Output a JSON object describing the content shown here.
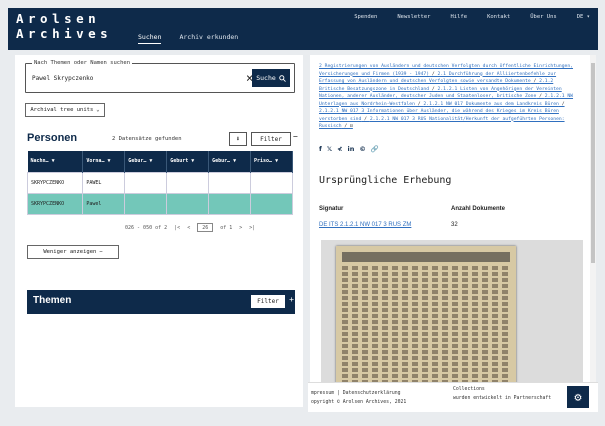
{
  "header": {
    "logo_line1": "Arolsen",
    "logo_line2": "Archives",
    "nav_main": [
      "Suchen",
      "Archiv erkunden"
    ],
    "nav_top": [
      "Spenden",
      "Newsletter",
      "Hilfe",
      "Kontakt",
      "Über Uns",
      "DE ▾"
    ]
  },
  "search": {
    "legend": "Nach Themen oder Namen suchen",
    "value": "Pawel Skrypczenko",
    "button_label": "Suche",
    "archival_label": "Archival tree units"
  },
  "personen": {
    "title": "Personen",
    "count": "2 Datensätze gefunden",
    "filter_label": "Filter",
    "columns": [
      "Nachn…",
      "Vorna…",
      "Gebur…",
      "Geburt",
      "Gebur…",
      "Priso…"
    ],
    "rows": [
      [
        "SKRYPCZENKO",
        "PAWEL",
        "",
        "",
        "",
        ""
      ],
      [
        "SKRYPCZENKO",
        "Pawel",
        "",
        "",
        "",
        ""
      ]
    ],
    "pager_range": "026 - 050 of 2",
    "pager_page": "26",
    "pager_of": "of 1",
    "less_label": "Weniger anzeigen"
  },
  "themen": {
    "title": "Themen",
    "filter_label": "Filter"
  },
  "detail": {
    "breadcrumb": [
      "2 Registrierungen von Ausländern und deutschen Verfolgten durch öffentliche Einrichtungen, Versicherungen und Firmen (1939 - 1947)",
      "2.1 Durchführung der Alliiertenbefehle zur Erfassung von Ausländern und deutschen Verfolgten sowie versandte Dokumente",
      "2.1.2 Britische Besatzungszone in Deutschland",
      "2.1.2.1 Listen von Angehörigen der Vereinten Nationen, anderer Ausländer, deutscher Juden und Staatenloser, britische Zone",
      "2.1.2.1 NW Unterlagen aus Nordrhein-Westfalen",
      "2.1.2.1 NW 017 Dokumente aus dem Landkreis Büren",
      "2.1.2.1 NW 017 3 Informationen über Ausländer, die während des Krieges im Kreis Büren verstorben sind",
      "2.1.2.1 NW 017 3 RUS Nationalität/Herkunft der aufgeführten Personen: Russisch"
    ],
    "share_icons": [
      "f",
      "𝕏",
      "≮",
      "in",
      "©",
      "🔗"
    ],
    "section_title": "Ursprüngliche Erhebung",
    "col_signatur": "Signatur",
    "col_anzahl": "Anzahl Dokumente",
    "signatur_value": "DE ITS 2.1.2.1 NW 017 3 RUS ZM",
    "anzahl_value": "32"
  },
  "footer": {
    "left_line1": "mpressum  |  Datenschutzerklärung",
    "left_line2": "opyright © Arolsen Archives, 2021",
    "right_line1": "Collections",
    "right_line2": "wurden entwickelt in Partnerschaft"
  }
}
